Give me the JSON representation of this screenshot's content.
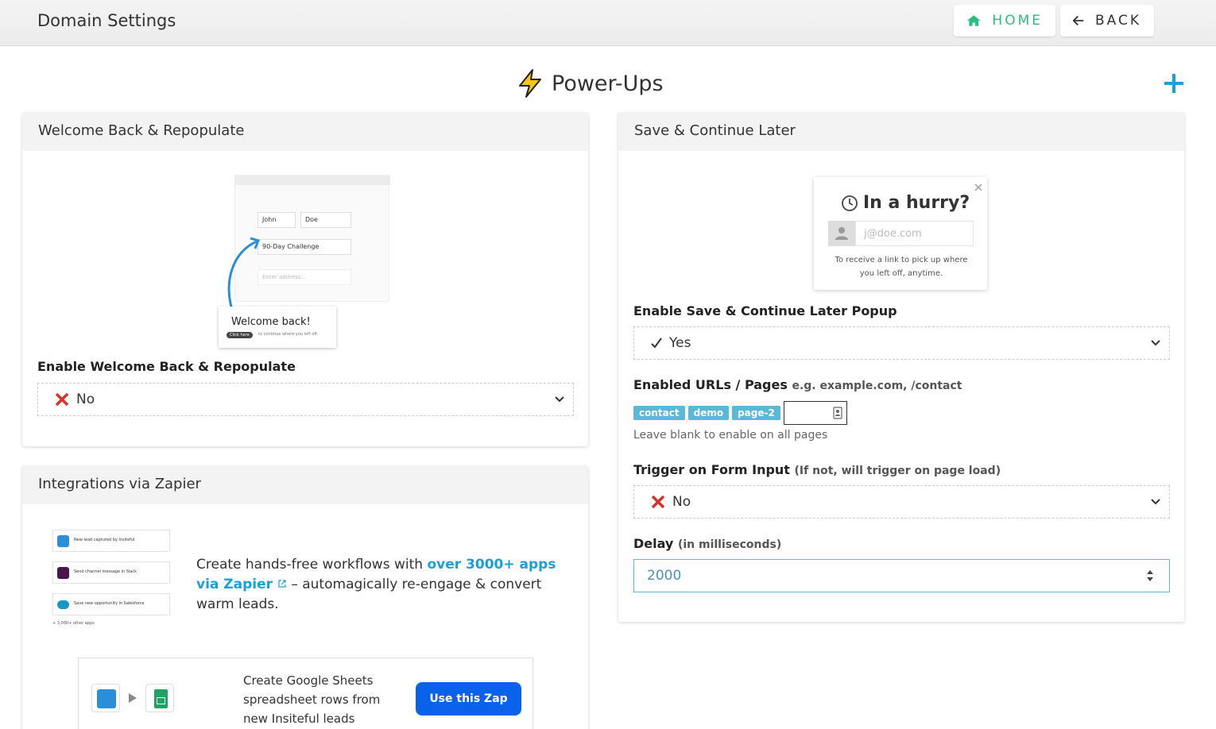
{
  "header": {
    "title": "Domain Settings",
    "home_label": "HOME",
    "back_label": "BACK"
  },
  "page": {
    "title": "Power-Ups"
  },
  "welcome_back": {
    "title": "Welcome Back & Repopulate",
    "enable_label": "Enable Welcome Back & Repopulate",
    "enable_value": "No",
    "preview": {
      "first_name": "John",
      "last_name": "Doe",
      "program": "90-Day Challenge",
      "email_placeholder": "Enter address...",
      "popup_title": "Welcome back!",
      "click_here": "Click here",
      "popup_text": "to continue where you left off."
    }
  },
  "save_continue": {
    "title": "Save & Continue Later",
    "preview": {
      "heading": "In a hurry?",
      "email_placeholder": "j@doe.com",
      "text_line1": "To receive a link to pick up where",
      "text_line2": "you left off, anytime."
    },
    "enable_label": "Enable Save & Continue Later Popup",
    "enable_value": "Yes",
    "urls_label": "Enabled URLs / Pages",
    "urls_example": "e.g. example.com, /contact",
    "url_tags": [
      "contact",
      "demo",
      "page-2"
    ],
    "urls_hint": "Leave blank to enable on all pages",
    "trigger_label": "Trigger on Form Input",
    "trigger_sub": "(If not, will trigger on page load)",
    "trigger_value": "No",
    "delay_label": "Delay",
    "delay_sub": "(in milliseconds)",
    "delay_value": "2000"
  },
  "zapier": {
    "title": "Integrations via Zapier",
    "text_before": "Create hands-free workflows with ",
    "link_text": "over 3000+ apps via Zapier",
    "text_after": " – automagically re-engage & convert warm leads.",
    "zap_desc": "Create Google Sheets spreadsheet rows from new Insiteful leads",
    "use_zap_label": "Use this Zap",
    "workflow": {
      "step1": "New lead captured by Insiteful",
      "step2": "Send channel message in Slack",
      "step3": "Save new opportunity in Salesforce",
      "more": "+ 3,000+ other apps"
    }
  },
  "colors": {
    "accent": "#1aa0d8",
    "home_green": "#2bbf7f",
    "tag_blue": "#5ab8d8",
    "zap_button": "#0b62ea",
    "no_red": "#d9302c"
  }
}
